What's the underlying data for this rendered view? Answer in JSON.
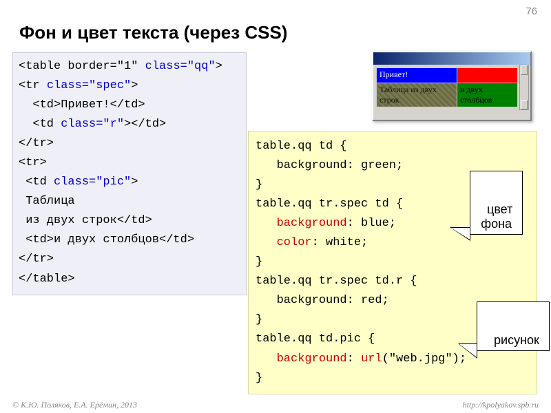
{
  "page_number": "76",
  "title": "Фон и цвет текста (через CSS)",
  "html_code": {
    "l1a": "<table border=\"1\" ",
    "l1b": "class=\"qq\"",
    "l1c": ">",
    "l2a": "<tr ",
    "l2b": "class=\"spec\"",
    "l2c": ">",
    "l3": "  <td>Привет!</td>",
    "l4a": "  <td ",
    "l4b": "class=\"r\"",
    "l4c": "></td>",
    "l5": "</tr>",
    "l6": "<tr>",
    "l7a": " <td ",
    "l7b": "class=\"pic\"",
    "l7c": ">",
    "l8": " Таблица",
    "l9": " из двух строк</td>",
    "l10": " <td>и двух столбцов</td>",
    "l11": "</tr>",
    "l12": "</table>"
  },
  "css_code": {
    "r1": "table.qq td {",
    "r2": "   background: green;",
    "r3": "}",
    "r4": "table.qq tr.spec td {",
    "r5a": "   ",
    "r5b": "background",
    "r5c": ": blue;",
    "r6a": "   ",
    "r6b": "color",
    "r6c": ": white;",
    "r7": "}",
    "r8": "table.qq tr.spec td.r {",
    "r9": "   background: red;",
    "r10": "}",
    "r11": "table.qq td.pic {",
    "r12a": "   ",
    "r12b": "background",
    "r12c": ": ",
    "r12d": "url",
    "r12e": "(\"web.jpg\");",
    "r13": "}"
  },
  "preview_table": {
    "row1": {
      "c1": "Привет!",
      "c2": ""
    },
    "row2": {
      "c1": "Таблица из двух строк",
      "c2": "и двух столбцов"
    }
  },
  "callouts": {
    "c1": "цвет\nфона",
    "c2": "рисунок"
  },
  "footer": {
    "left": "© К.Ю. Поляков, Е.А. Ерёмин, 2013",
    "right": "http://kpolyakov.spb.ru"
  }
}
